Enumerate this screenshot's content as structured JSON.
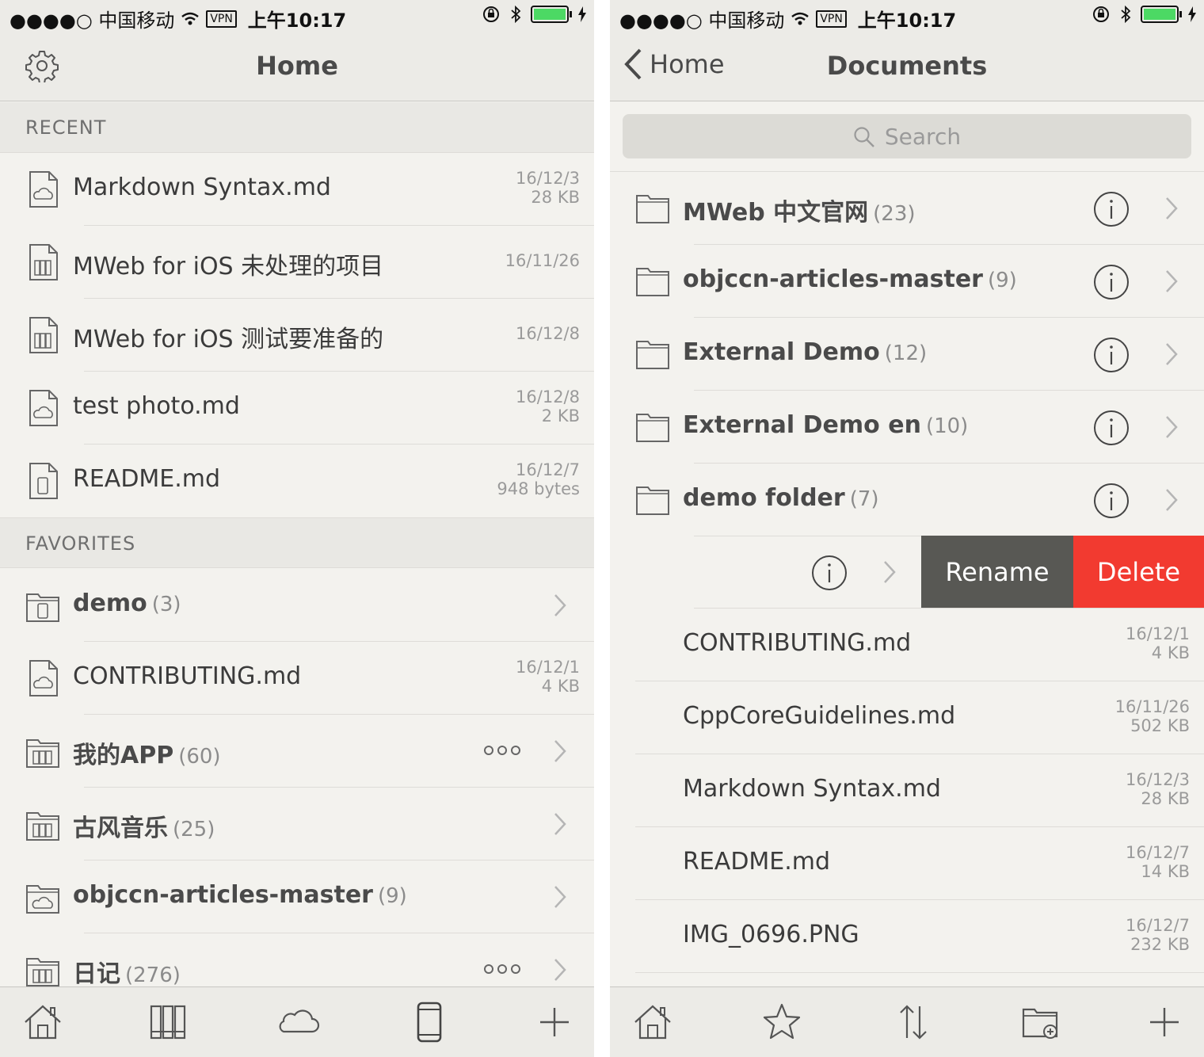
{
  "status_bar": {
    "carrier": "●●●●○ 中国移动",
    "vpn": "VPN",
    "time": "上午10:17",
    "battery_color": "#4cd964"
  },
  "left": {
    "title": "Home",
    "recent_header": "RECENT",
    "recent": [
      {
        "name": "Markdown Syntax.md",
        "date": "16/12/3",
        "size": "28 KB",
        "icon": "cloud-document-icon"
      },
      {
        "name": "MWeb for iOS 未处理的项目",
        "date": "16/11/26",
        "size": "",
        "icon": "library-document-icon"
      },
      {
        "name": "MWeb for iOS 测试要准备的",
        "date": "16/12/8",
        "size": "",
        "icon": "library-document-icon"
      },
      {
        "name": "test photo.md",
        "date": "16/12/8",
        "size": "2 KB",
        "icon": "cloud-document-icon"
      },
      {
        "name": "README.md",
        "date": "16/12/7",
        "size": "948 bytes",
        "icon": "phone-document-icon"
      }
    ],
    "favorites_header": "FAVORITES",
    "favorites": [
      {
        "name": "demo",
        "count": "(3)",
        "icon": "phone-folder-icon"
      },
      {
        "name": "CONTRIBUTING.md",
        "date": "16/12/1",
        "size": "4 KB",
        "icon": "cloud-document-icon"
      },
      {
        "name": "我的APP",
        "count": "(60)",
        "icon": "library-folder-icon"
      },
      {
        "name": "古风音乐",
        "count": "(25)",
        "icon": "library-folder-icon"
      },
      {
        "name": "objccn-articles-master",
        "count": "(9)",
        "icon": "cloud-folder-icon"
      },
      {
        "name": "日记",
        "count": "(276)",
        "icon": "library-folder-icon"
      }
    ]
  },
  "right": {
    "back_label": "Home",
    "title": "Documents",
    "search_placeholder": "Search",
    "folders": [
      {
        "name": "MWeb 中文官网",
        "count": "(23)"
      },
      {
        "name": "objccn-articles-master",
        "count": "(9)"
      },
      {
        "name": "External Demo",
        "count": "(12)"
      },
      {
        "name": "External Demo en",
        "count": "(10)"
      },
      {
        "name": "demo folder",
        "count": "(7)"
      }
    ],
    "swipe_actions": {
      "rename": "Rename",
      "delete": "Delete"
    },
    "files": [
      {
        "name": "CONTRIBUTING.md",
        "date": "16/12/1",
        "size": "4 KB"
      },
      {
        "name": "CppCoreGuidelines.md",
        "date": "16/11/26",
        "size": "502 KB"
      },
      {
        "name": "Markdown Syntax.md",
        "date": "16/12/3",
        "size": "28 KB"
      },
      {
        "name": "README.md",
        "date": "16/12/7",
        "size": "14 KB"
      },
      {
        "name": "IMG_0696.PNG",
        "date": "16/12/7",
        "size": "232 KB"
      }
    ]
  },
  "colors": {
    "background": "#f3f2ee",
    "bar": "#ecebe7",
    "rename": "#585854",
    "delete": "#f23a30"
  }
}
